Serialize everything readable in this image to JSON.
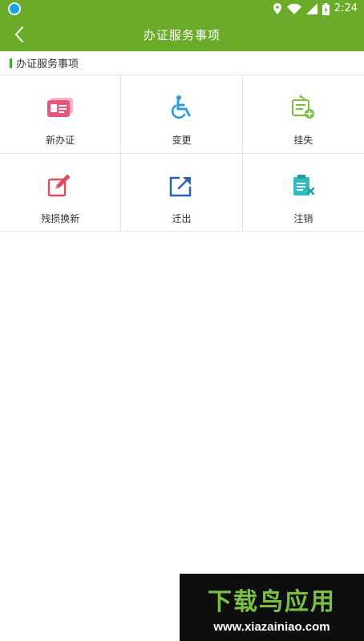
{
  "status_bar": {
    "time": "2:24"
  },
  "app_bar": {
    "title": "办证服务事项"
  },
  "section": {
    "title": "办证服务事项"
  },
  "services": [
    {
      "label": "新办证",
      "icon": "id-card-icon"
    },
    {
      "label": "变更",
      "icon": "wheelchair-icon"
    },
    {
      "label": "挂失",
      "icon": "report-loss-icon"
    },
    {
      "label": "残损换新",
      "icon": "edit-icon"
    },
    {
      "label": "迁出",
      "icon": "move-out-icon"
    },
    {
      "label": "注销",
      "icon": "cancel-clipboard-icon"
    }
  ],
  "colors": {
    "primary": "#6bab2a",
    "accent_pink": "#e8557b",
    "accent_blue": "#2a9fd6",
    "accent_green": "#7cc043",
    "accent_red": "#e04a5a",
    "accent_navy": "#2a64b8",
    "accent_teal": "#2fbcc0"
  },
  "watermark": {
    "brand": "下载鸟应用",
    "url": "www.xiazainiao.com"
  }
}
